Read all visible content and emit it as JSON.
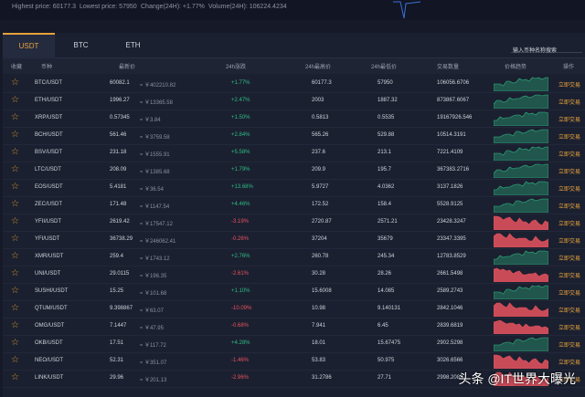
{
  "top_stats": {
    "highest": "Highest price: 60177.3",
    "lowest": "Lowest price: 57950",
    "change": "Change(24H): +1.77%",
    "volume": "Volume(24H): 106224.4234"
  },
  "tabs": [
    {
      "label": "USDT",
      "active": true
    },
    {
      "label": "BTC",
      "active": false
    },
    {
      "label": "ETH",
      "active": false
    }
  ],
  "search": {
    "placeholder": "输入币种名称搜索"
  },
  "columns": [
    "收藏",
    "币种",
    "最新价",
    "24h涨跌",
    "24h最高价",
    "24h最低价",
    "交易数量",
    "价格趋势",
    "操作"
  ],
  "trade_label": "立即交易",
  "colors": {
    "up": "#2ebd85",
    "down": "#e8535f",
    "accent": "#e6a23c"
  },
  "rows": [
    {
      "pair": "BTC/USDT",
      "price": "60082.1",
      "cny": "≈ ￥402210.82",
      "change": "+1.77%",
      "high": "60177.3",
      "low": "57950",
      "volume": "106056.6706",
      "trend": "up"
    },
    {
      "pair": "ETH/USDT",
      "price": "1996.27",
      "cny": "≈ ￥13365.58",
      "change": "+2.47%",
      "high": "2003",
      "low": "1887.32",
      "volume": "873867.6067",
      "trend": "up"
    },
    {
      "pair": "XRP/USDT",
      "price": "0.57345",
      "cny": "≈ ￥3.84",
      "change": "+1.50%",
      "high": "0.5813",
      "low": "0.5535",
      "volume": "19167926.546",
      "trend": "up"
    },
    {
      "pair": "BCH/USDT",
      "price": "561.46",
      "cny": "≈ ￥3759.58",
      "change": "+2.84%",
      "high": "565.26",
      "low": "529.88",
      "volume": "10514.3191",
      "trend": "up"
    },
    {
      "pair": "BSV/USDT",
      "price": "231.18",
      "cny": "≈ ￥1555.91",
      "change": "+5.58%",
      "high": "237.6",
      "low": "213.1",
      "volume": "7221.4109",
      "trend": "up"
    },
    {
      "pair": "LTC/USDT",
      "price": "208.09",
      "cny": "≈ ￥1385.68",
      "change": "+1.79%",
      "high": "209.9",
      "low": "195.7",
      "volume": "367383.2716",
      "trend": "up"
    },
    {
      "pair": "EOS/USDT",
      "price": "5.4181",
      "cny": "≈ ￥36.54",
      "change": "+13.68%",
      "high": "5.9727",
      "low": "4.0362",
      "volume": "3137.1826",
      "trend": "up"
    },
    {
      "pair": "ZEC/USDT",
      "price": "171.48",
      "cny": "≈ ￥1147.54",
      "change": "+4.46%",
      "high": "172.52",
      "low": "158.4",
      "volume": "5528.9125",
      "trend": "up"
    },
    {
      "pair": "YFII/USDT",
      "price": "2619.42",
      "cny": "≈ ￥17547.12",
      "change": "-3.19%",
      "high": "2720.87",
      "low": "2571.21",
      "volume": "23428.3247",
      "trend": "down"
    },
    {
      "pair": "YFI/USDT",
      "price": "36738.29",
      "cny": "≈ ￥246062.41",
      "change": "-0.26%",
      "high": "37204",
      "low": "35679",
      "volume": "23347.3395",
      "trend": "down"
    },
    {
      "pair": "XMR/USDT",
      "price": "259.4",
      "cny": "≈ ￥1743.12",
      "change": "+2.76%",
      "high": "260.78",
      "low": "245.34",
      "volume": "12783.8529",
      "trend": "up"
    },
    {
      "pair": "UNI/USDT",
      "price": "29.0115",
      "cny": "≈ ￥196.35",
      "change": "-2.61%",
      "high": "30.28",
      "low": "28.26",
      "volume": "2661.5498",
      "trend": "down"
    },
    {
      "pair": "SUSHI/USDT",
      "price": "15.25",
      "cny": "≈ ￥101.68",
      "change": "+1.10%",
      "high": "15.6008",
      "low": "14.085",
      "volume": "2589.2743",
      "trend": "up"
    },
    {
      "pair": "QTUM/USDT",
      "price": "9.398867",
      "cny": "≈ ￥63.07",
      "change": "-10.09%",
      "high": "10.98",
      "low": "9.140131",
      "volume": "2842.1046",
      "trend": "down"
    },
    {
      "pair": "OMG/USDT",
      "price": "7.1447",
      "cny": "≈ ￥47.95",
      "change": "-0.68%",
      "high": "7.941",
      "low": "6.45",
      "volume": "2839.6819",
      "trend": "down"
    },
    {
      "pair": "OKB/USDT",
      "price": "17.51",
      "cny": "≈ ￥117.72",
      "change": "+4.28%",
      "high": "18.01",
      "low": "15.67475",
      "volume": "2902.5298",
      "trend": "up"
    },
    {
      "pair": "NEO/USDT",
      "price": "52.31",
      "cny": "≈ ￥351.07",
      "change": "-1.46%",
      "high": "53.83",
      "low": "50.975",
      "volume": "3026.6566",
      "trend": "down"
    },
    {
      "pair": "LINK/USDT",
      "price": "29.96",
      "cny": "≈ ￥201.13",
      "change": "-2.96%",
      "high": "31.2786",
      "low": "27.71",
      "volume": "2998.2083",
      "trend": "down"
    }
  ],
  "watermark": "头条 @IT世界大曝光"
}
